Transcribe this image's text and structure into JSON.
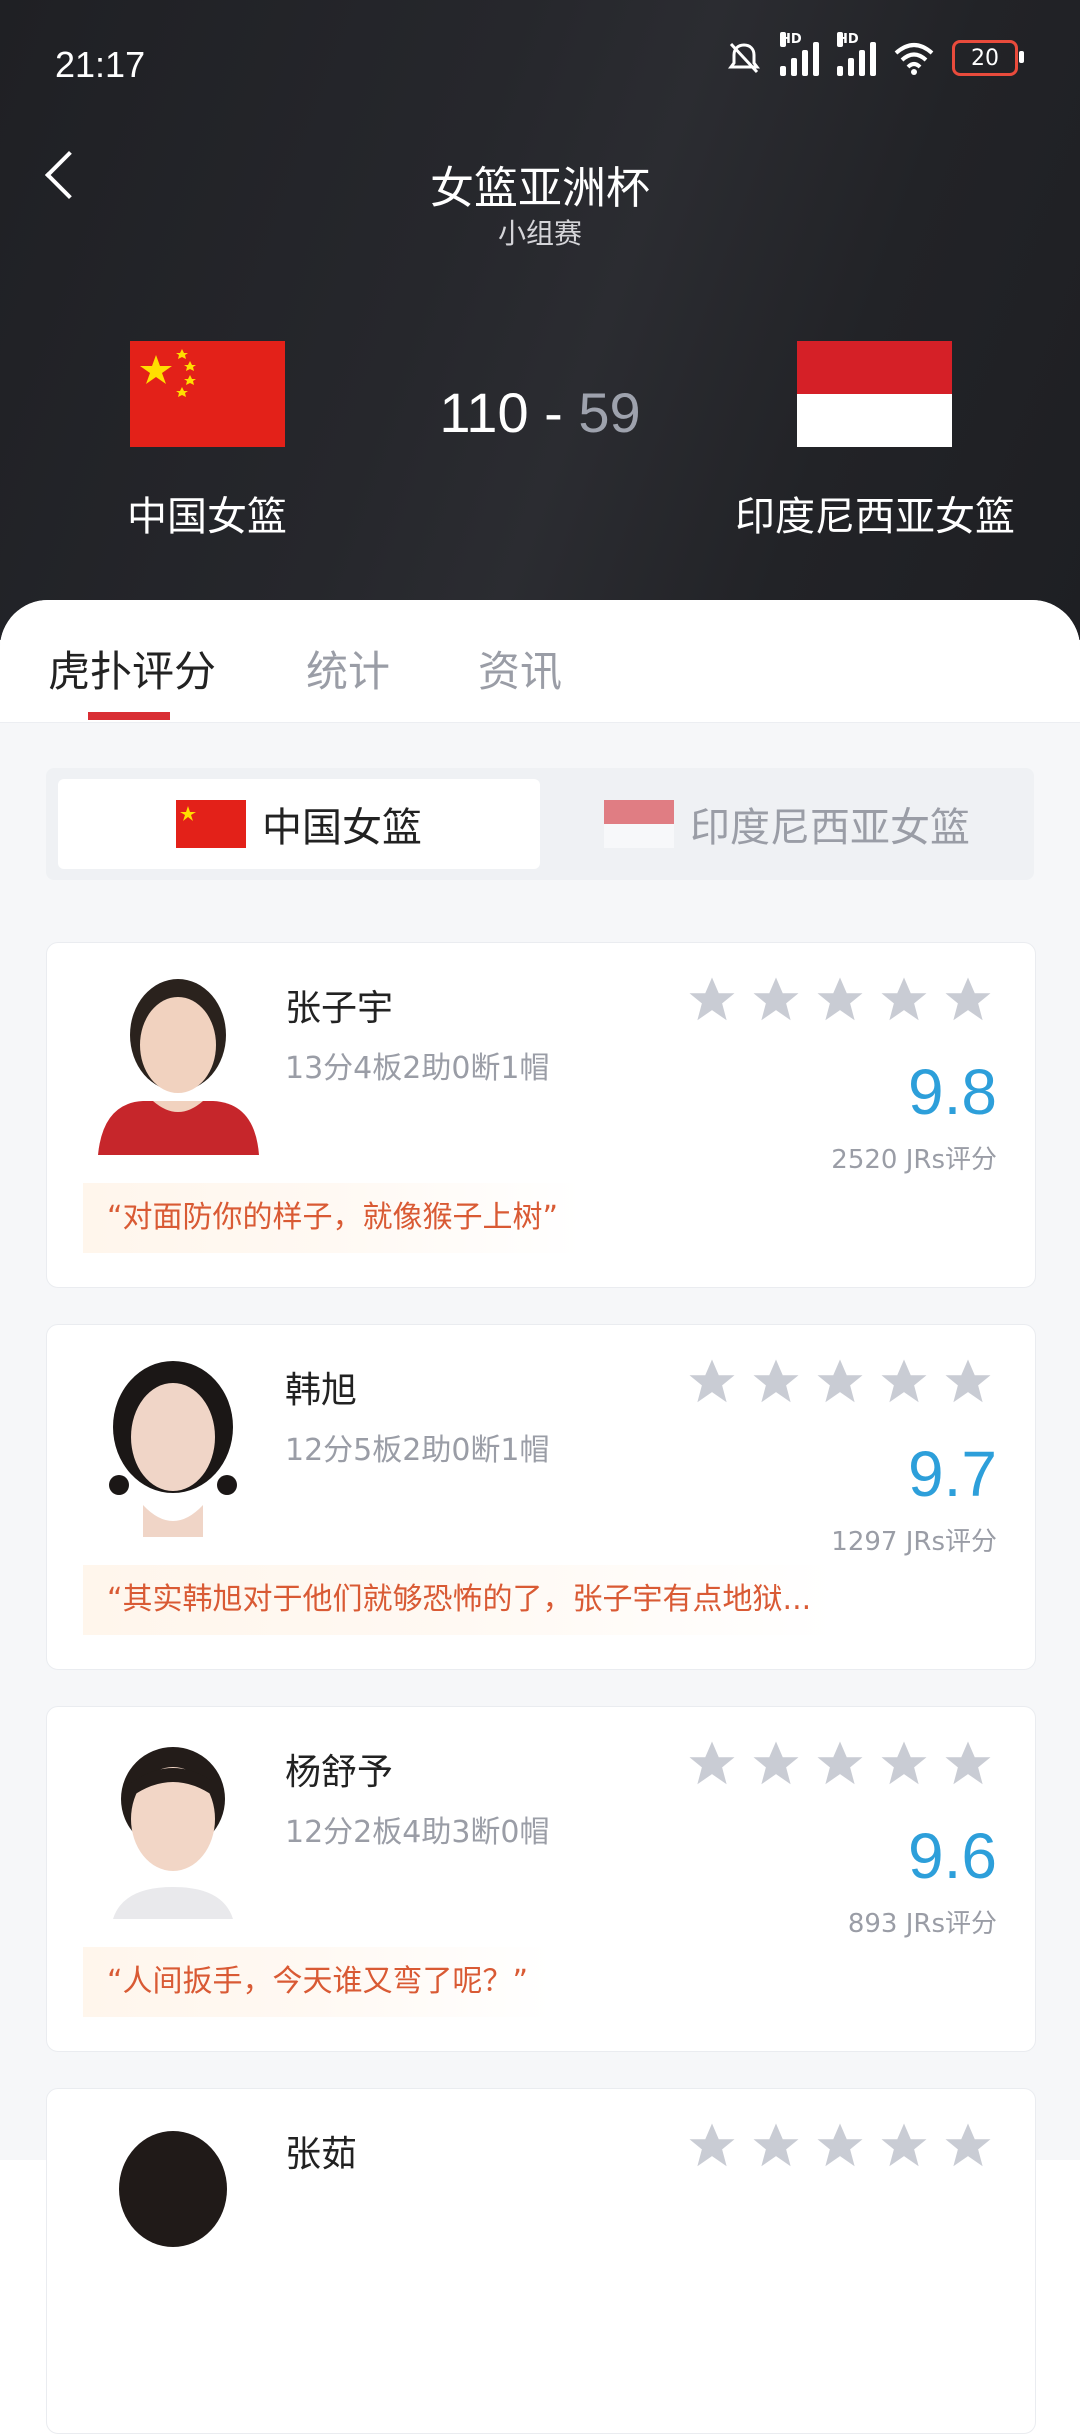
{
  "status_bar": {
    "time": "21:17",
    "battery": "20",
    "hd_label": "HD"
  },
  "header": {
    "title": "女篮亚洲杯",
    "subtitle": "小组赛",
    "home_team": "中国女篮",
    "away_team": "印度尼西亚女篮",
    "home_score": "110",
    "separator": "-",
    "away_score": "59"
  },
  "tabs": [
    {
      "label": "虎扑评分",
      "active": true
    },
    {
      "label": "统计",
      "active": false
    },
    {
      "label": "资讯",
      "active": false
    }
  ],
  "team_toggle": {
    "selected": "中国女篮",
    "other": "印度尼西亚女篮"
  },
  "players": [
    {
      "name": "张子宇",
      "stats": "13分4板2助0断1帽",
      "rating": "9.8",
      "votes": "2520 JRs评分",
      "quote": "“对面防你的样子，就像猴子上树”"
    },
    {
      "name": "韩旭",
      "stats": "12分5板2助0断1帽",
      "rating": "9.7",
      "votes": "1297 JRs评分",
      "quote": "“其实韩旭对于他们就够恐怖的了，张子宇有点地狱..."
    },
    {
      "name": "杨舒予",
      "stats": "12分2板4助3断0帽",
      "rating": "9.6",
      "votes": "893 JRs评分",
      "quote": "“人间扳手，今天谁又弯了呢？”"
    },
    {
      "name": "张茹",
      "stats": "",
      "rating": "",
      "votes": "",
      "quote": ""
    }
  ],
  "colors": {
    "header_bg": "#26272c",
    "accent_red": "#d92e34",
    "rating_blue": "#2d9fda",
    "quote_orange": "#d95a34"
  }
}
